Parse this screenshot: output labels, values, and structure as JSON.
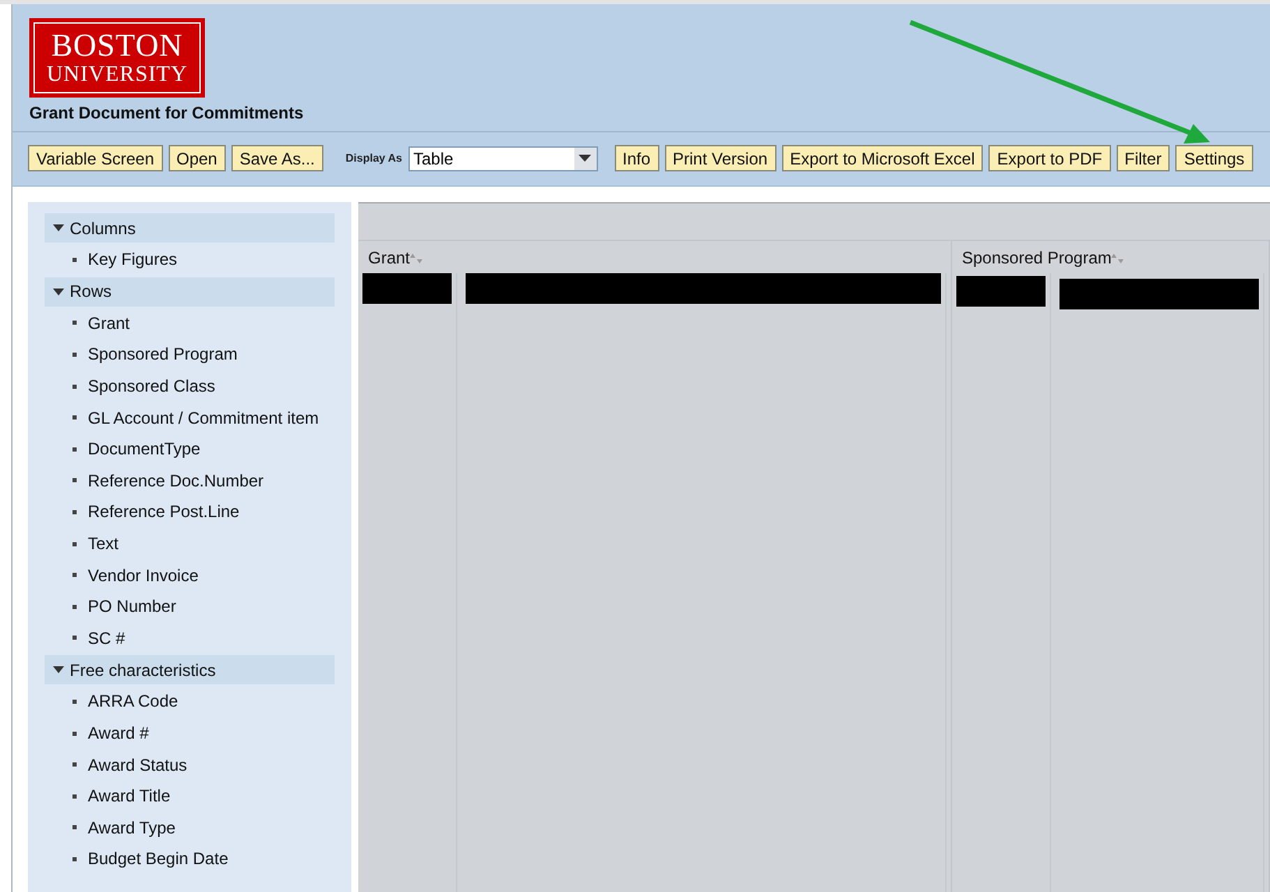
{
  "logo": {
    "line1": "BOSTON",
    "line2": "UNIVERSITY"
  },
  "title": "Grant Document for Commitments",
  "toolbar": {
    "left_buttons": [
      "Variable Screen",
      "Open",
      "Save As..."
    ],
    "display_as": {
      "label": "Display As",
      "value": "Table"
    },
    "right_buttons": [
      "Info",
      "Print Version",
      "Export to Microsoft Excel",
      "Export to PDF",
      "Filter",
      "Settings"
    ]
  },
  "navigation": {
    "sections": [
      {
        "label": "Columns",
        "expanded": true,
        "items": [
          "Key Figures"
        ]
      },
      {
        "label": "Rows",
        "expanded": true,
        "items": [
          "Grant",
          "Sponsored Program",
          "Sponsored Class",
          "GL Account / Commitment item",
          "DocumentType",
          "Reference Doc.Number",
          "Reference Post.Line",
          "Text",
          "Vendor Invoice",
          "PO Number",
          "SC #"
        ]
      },
      {
        "label": "Free characteristics",
        "expanded": true,
        "items": [
          "ARRA Code",
          "Award #",
          "Award Status",
          "Award Title",
          "Award Type",
          "Budget Begin Date"
        ]
      }
    ]
  },
  "table": {
    "columns": [
      {
        "label": "Grant"
      },
      {
        "label": "Sponsored Program"
      }
    ]
  }
}
